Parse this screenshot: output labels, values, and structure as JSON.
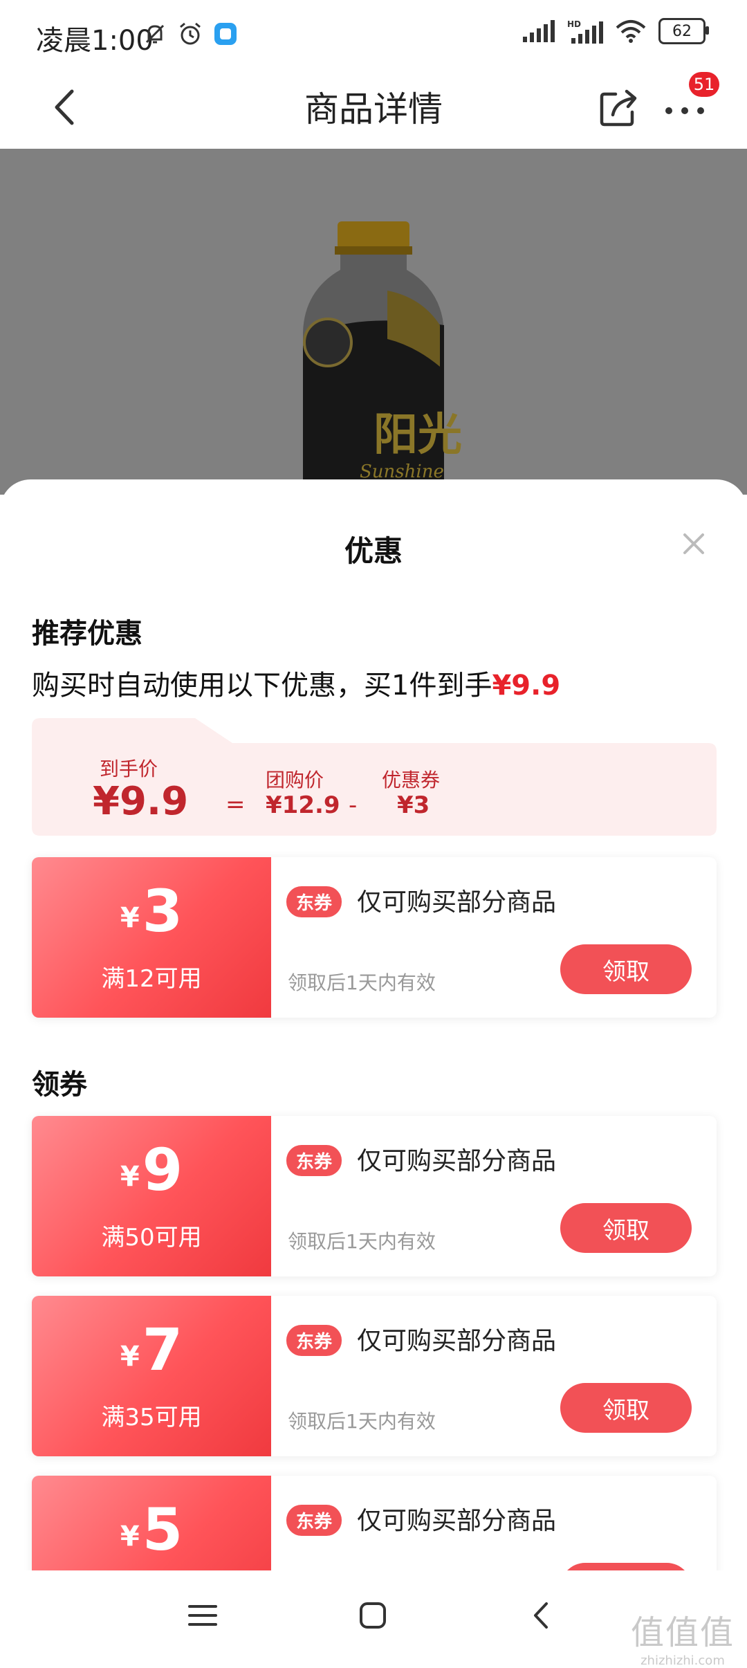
{
  "status_bar": {
    "time": "凌晨1:00",
    "battery": "62",
    "icons": [
      "mute-bell-icon",
      "alarm-icon",
      "app-icon",
      "signal-icon",
      "hd-signal-icon",
      "wifi-icon",
      "battery-icon"
    ]
  },
  "nav": {
    "title": "商品详情",
    "badge_count": "51"
  },
  "product_image": {
    "brand_text": "阳光",
    "brand_sub": "Sunshine"
  },
  "sheet": {
    "title": "优惠",
    "recommend_title": "推荐优惠",
    "recommend_text_prefix": "购买时自动使用以下优惠，买1件到手",
    "recommend_price": "¥9.9",
    "price_breakdown": {
      "final_label": "到手价",
      "final_price": "¥9.9",
      "equals": "=",
      "group_label": "团购价",
      "group_price": "¥12.9",
      "minus": "-",
      "coupon_label": "优惠券",
      "coupon_value": "¥3"
    },
    "coupons_section_title": "领券"
  },
  "recommended_coupon": {
    "currency": "¥",
    "amount": "3",
    "condition": "满12可用",
    "tag": "东券",
    "desc": "仅可购买部分商品",
    "validity": "领取后1天内有效",
    "button": "领取"
  },
  "coupons": [
    {
      "currency": "¥",
      "amount": "9",
      "condition": "满50可用",
      "tag": "东券",
      "desc": "仅可购买部分商品",
      "validity": "领取后1天内有效",
      "button": "领取"
    },
    {
      "currency": "¥",
      "amount": "7",
      "condition": "满35可用",
      "tag": "东券",
      "desc": "仅可购买部分商品",
      "validity": "领取后1天内有效",
      "button": "领取"
    },
    {
      "currency": "¥",
      "amount": "5",
      "tag": "东券",
      "desc": "仅可购买部分商品"
    }
  ],
  "watermark": {
    "big": "值值值",
    "small": "zhizhizhi.com"
  },
  "colors": {
    "accent": "#e8222b",
    "coupon_gradient_start": "#ff8a8f",
    "coupon_gradient_end": "#f03a3f",
    "price_box_bg": "#fdeeee"
  }
}
